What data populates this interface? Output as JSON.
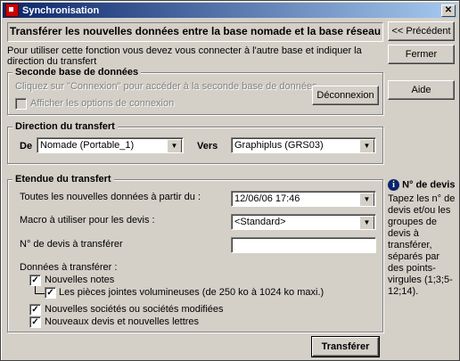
{
  "window": {
    "title": "Synchronisation"
  },
  "banner": {
    "text": "Transférer les nouvelles données entre la base nomade et la base réseau"
  },
  "intro": {
    "text": "Pour utiliser cette fonction vous devez vous connecter à l'autre base et indiquer la direction du transfert"
  },
  "buttons": {
    "previous": "<< Précédent",
    "close": "Fermer",
    "disconnect": "Déconnexion",
    "help": "Aide",
    "transfer": "Transférer"
  },
  "second_db": {
    "title": "Seconde base de données",
    "hint": "Cliquez sur \"Connexion\" pour accéder à la seconde base de données.",
    "show_options_label": "Afficher les options de connexion",
    "show_options_checked": false
  },
  "direction": {
    "title": "Direction du transfert",
    "from_label": "De",
    "from_value": "Nomade (Portable_1)",
    "to_label": "Vers",
    "to_value": "Graphiplus (GRS03)"
  },
  "scope": {
    "title": "Etendue du transfert",
    "since_label": "Toutes les nouvelles données à partir du :",
    "since_value": "12/06/06 17:46",
    "macro_label": "Macro à utiliser pour les devis :",
    "macro_value": "<Standard>",
    "quote_no_label": "N° de devis à transférer",
    "quote_no_value": "",
    "data_label": "Données à transférer :",
    "items": [
      {
        "label": "Nouvelles notes",
        "checked": true
      },
      {
        "label": "Les pièces jointes volumineuses (de 250 ko à 1024 ko maxi.)",
        "checked": true
      },
      {
        "label": "Nouvelles sociétés ou sociétés modifiées",
        "checked": true
      },
      {
        "label": "Nouveaux devis et nouvelles lettres",
        "checked": true
      }
    ]
  },
  "info_panel": {
    "icon": "info-icon",
    "title": "N° de devis",
    "text": "Tapez les n° de devis et/ou les groupes de devis à transférer, séparés par des points-virgules (1;3;5-12;14)."
  }
}
